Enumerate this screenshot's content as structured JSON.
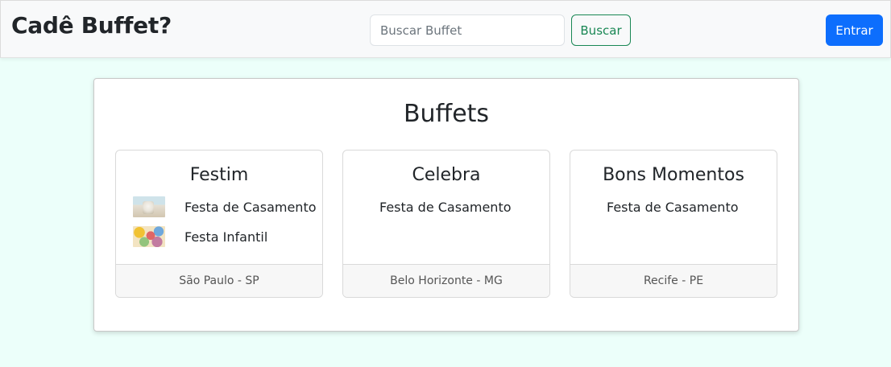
{
  "header": {
    "brand": "Cadê Buffet?",
    "search_placeholder": "Buscar Buffet",
    "search_value": "",
    "search_button": "Buscar",
    "login_button": "Entrar"
  },
  "main": {
    "title": "Buffets",
    "buffets": [
      {
        "name": "Festim",
        "events": [
          {
            "label": "Festa de Casamento",
            "thumb": "wedding-photo"
          },
          {
            "label": "Festa Infantil",
            "thumb": "kids-party-photo"
          }
        ],
        "location": "São Paulo - SP"
      },
      {
        "name": "Celebra",
        "events": [
          {
            "label": "Festa de Casamento"
          }
        ],
        "location": "Belo Horizonte - MG"
      },
      {
        "name": "Bons Momentos",
        "events": [
          {
            "label": "Festa de Casamento"
          }
        ],
        "location": "Recife - PE"
      }
    ]
  },
  "colors": {
    "page_background": "#ecfffa",
    "search_button": "#198754",
    "login_button": "#0d6efd"
  }
}
